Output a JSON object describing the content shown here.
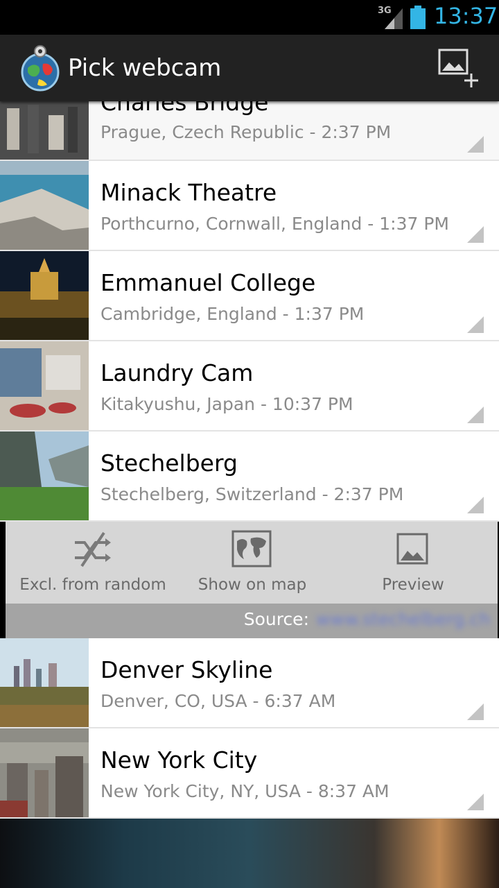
{
  "status_bar": {
    "network": "3G",
    "time": "13:37",
    "accent": "#33b5e5"
  },
  "action_bar": {
    "title": "Pick webcam",
    "app_icon": "globe-webcam-icon",
    "add_action_icon": "add-image-icon"
  },
  "webcams": [
    {
      "title": "Charles Bridge",
      "subtitle": "Prague, Czech Republic - 2:37 PM",
      "thumb": "crowd-bridge"
    },
    {
      "title": "Minack Theatre",
      "subtitle": "Porthcurno, Cornwall, England - 1:37 PM",
      "thumb": "coast"
    },
    {
      "title": "Emmanuel College",
      "subtitle": "Cambridge, England - 1:37 PM",
      "thumb": "night-building"
    },
    {
      "title": "Laundry Cam",
      "subtitle": "Kitakyushu, Japan - 10:37 PM",
      "thumb": "laundry"
    },
    {
      "title": "Stechelberg",
      "subtitle": "Stechelberg, Switzerland - 2:37 PM",
      "thumb": "valley"
    }
  ],
  "expanded_actions": {
    "exclude_label": "Excl. from random",
    "map_label": "Show on map",
    "preview_label": "Preview",
    "source_label": "Source:",
    "source_link": "www.stechelberg.ch"
  },
  "webcams_after": [
    {
      "title": "Denver Skyline",
      "subtitle": "Denver, CO, USA - 6:37 AM",
      "thumb": "city-skyline"
    },
    {
      "title": "New York City",
      "subtitle": "New York City, NY, USA - 8:37 AM",
      "thumb": "city-haze"
    }
  ]
}
